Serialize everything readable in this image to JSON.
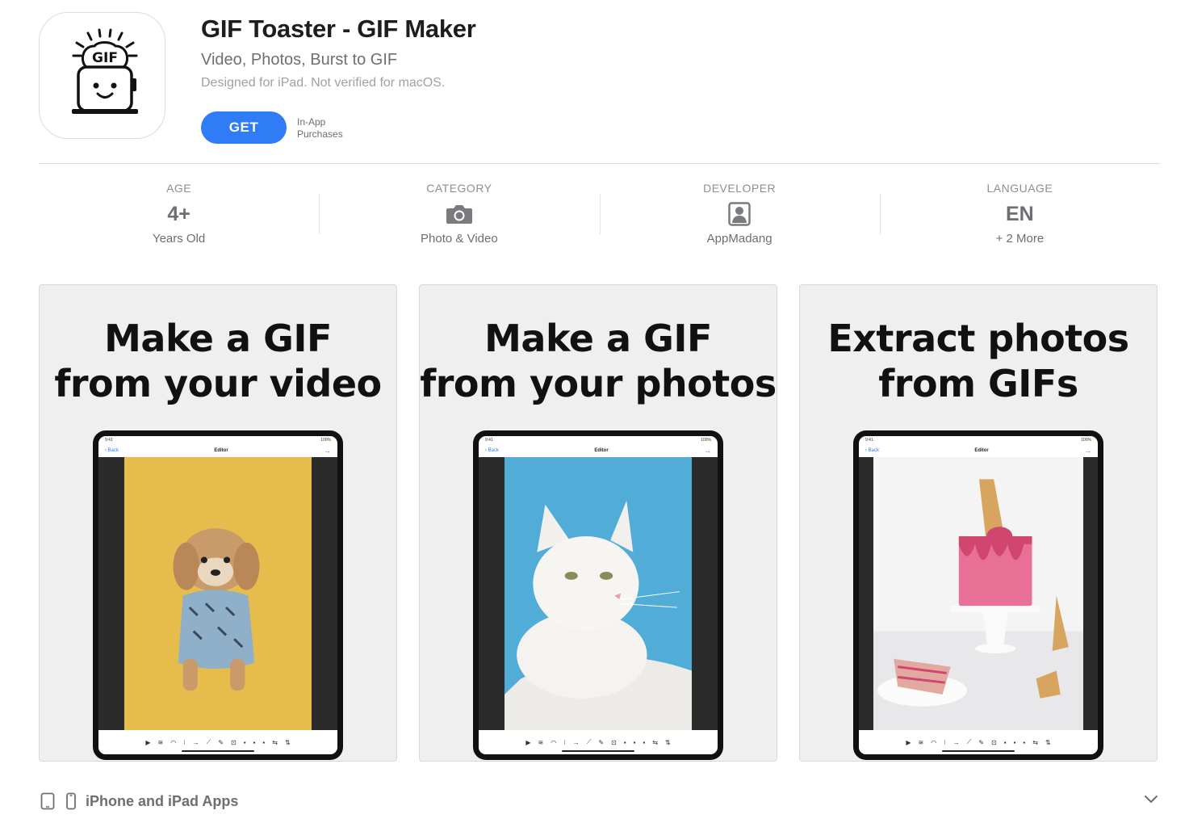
{
  "app": {
    "title": "GIF Toaster - GIF Maker",
    "subtitle": "Video, Photos, Burst to GIF",
    "designed_for": "Designed for iPad. Not verified for macOS.",
    "get_label": "GET",
    "iap_line1": "In-App",
    "iap_line2": "Purchases",
    "icon": "gif-toaster-icon",
    "icon_text": "GIF"
  },
  "info": {
    "age": {
      "label": "AGE",
      "value": "4+",
      "sub": "Years Old"
    },
    "category": {
      "label": "CATEGORY",
      "icon": "camera-icon",
      "sub": "Photo & Video"
    },
    "developer": {
      "label": "DEVELOPER",
      "icon": "person-icon",
      "sub": "AppMadang"
    },
    "language": {
      "label": "LANGUAGE",
      "value": "EN",
      "sub": "+ 2 More"
    }
  },
  "screenshots": [
    {
      "caption": "Make a GIF\nfrom your video",
      "photo": "dog-on-yellow"
    },
    {
      "caption": "Make a GIF\nfrom your photos",
      "photo": "white-cat-on-blue"
    },
    {
      "caption": "Extract photos\nfrom GIFs",
      "photo": "pink-cake"
    }
  ],
  "footer": {
    "label": "iPhone and iPad Apps"
  },
  "colors": {
    "accent": "#2f7cf6",
    "text": "#1d1d1f",
    "secondary": "#6e6e73"
  }
}
